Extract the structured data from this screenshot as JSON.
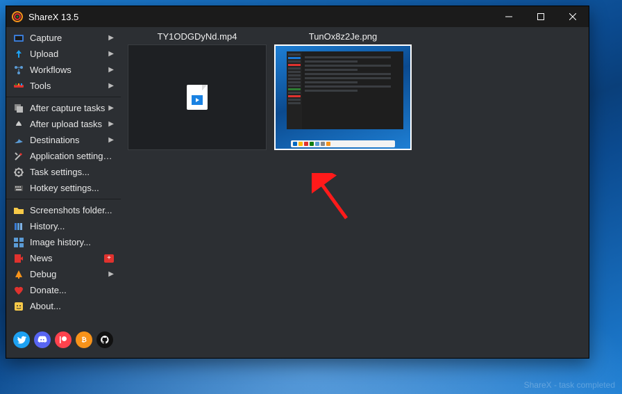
{
  "app": {
    "title": "ShareX 13.5"
  },
  "window_controls": {
    "min": "minimize",
    "max": "maximize",
    "close": "close"
  },
  "sidebar": {
    "items": [
      {
        "icon": "capture-icon",
        "label": "Capture",
        "has_arrow": true
      },
      {
        "icon": "upload-icon",
        "label": "Upload",
        "has_arrow": true
      },
      {
        "icon": "workflows-icon",
        "label": "Workflows",
        "has_arrow": true
      },
      {
        "icon": "tools-icon",
        "label": "Tools",
        "has_arrow": true
      }
    ],
    "items2": [
      {
        "icon": "after-capture-icon",
        "label": "After capture tasks",
        "has_arrow": true
      },
      {
        "icon": "after-upload-icon",
        "label": "After upload tasks",
        "has_arrow": true
      },
      {
        "icon": "destinations-icon",
        "label": "Destinations",
        "has_arrow": true
      },
      {
        "icon": "app-settings-icon",
        "label": "Application settings...",
        "has_arrow": false
      },
      {
        "icon": "task-settings-icon",
        "label": "Task settings...",
        "has_arrow": false
      },
      {
        "icon": "hotkey-settings-icon",
        "label": "Hotkey settings...",
        "has_arrow": false
      }
    ],
    "items3": [
      {
        "icon": "folder-icon",
        "label": "Screenshots folder...",
        "has_arrow": false
      },
      {
        "icon": "history-icon",
        "label": "History...",
        "has_arrow": false
      },
      {
        "icon": "image-history-icon",
        "label": "Image history...",
        "has_arrow": false
      },
      {
        "icon": "news-icon",
        "label": "News",
        "has_arrow": false,
        "badge": "+"
      },
      {
        "icon": "debug-icon",
        "label": "Debug",
        "has_arrow": true
      },
      {
        "icon": "donate-icon",
        "label": "Donate...",
        "has_arrow": false
      },
      {
        "icon": "about-icon",
        "label": "About...",
        "has_arrow": false
      }
    ]
  },
  "socials": [
    {
      "name": "twitter",
      "color": "#1da1f2"
    },
    {
      "name": "discord",
      "color": "#5865f2"
    },
    {
      "name": "patreon",
      "color": "#ff424d"
    },
    {
      "name": "bitcoin",
      "color": "#f7931a"
    },
    {
      "name": "github",
      "color": "#111111"
    }
  ],
  "files": [
    {
      "name": "TY1ODGDyNd.mp4",
      "type": "video",
      "selected": true
    },
    {
      "name": "TunOx8z2Je.png",
      "type": "image",
      "selected": false
    }
  ],
  "status_hint": "ShareX - task completed"
}
